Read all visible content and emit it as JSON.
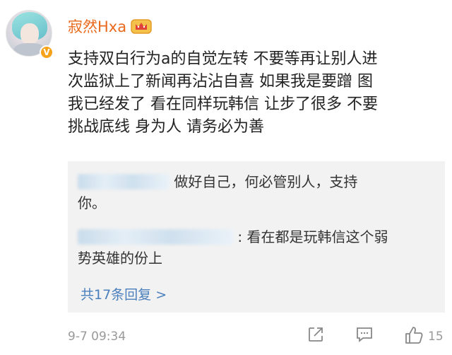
{
  "user": {
    "name": "寂然Hxa",
    "verified_badge": "V"
  },
  "post": {
    "lines": [
      "支持双白行为a的自觉左转 不要等再让别人进",
      "次监狱上了新闻再沾沾自喜 如果我是要蹭 图",
      "我已经发了 看在同样玩韩信 让步了很多 不要",
      "挑战底线  身为人 请务必为善"
    ]
  },
  "replies": [
    {
      "text_line1": "做好自己，何必管别人，支持",
      "text_line2": "你。"
    },
    {
      "text_line1": ": 看在都是玩韩信这个弱",
      "text_line2": "势英雄的份上"
    }
  ],
  "more_replies": "共17条回复 >",
  "footer": {
    "timestamp": "9-7 09:34",
    "like_count": "15"
  },
  "icons": {
    "crown": "crown-badge-icon",
    "share": "share-icon",
    "comment": "comment-icon",
    "like": "thumbs-up-icon"
  },
  "colors": {
    "username": "#e96a1e",
    "link": "#4a7fbd",
    "badge": "#f7a21b"
  }
}
